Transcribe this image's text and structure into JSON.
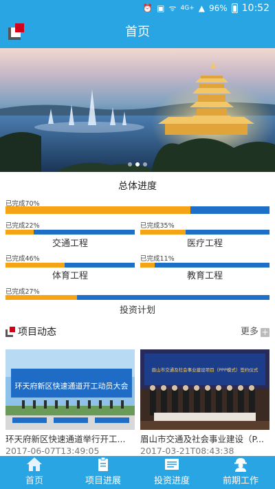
{
  "status_bar": {
    "battery": "96%",
    "time": "10:52",
    "network": "4G+"
  },
  "app_bar": {
    "title": "首页"
  },
  "banner": {
    "slides": 3,
    "active_slide": 1
  },
  "progress": {
    "title": "总体进度",
    "overall": {
      "text": "已完成70%",
      "percent": 70
    },
    "items": [
      {
        "text": "已完成22%",
        "label": "交通工程",
        "percent": 22
      },
      {
        "text": "已完成35%",
        "label": "医疗工程",
        "percent": 35
      },
      {
        "text": "已完成46%",
        "label": "体育工程",
        "percent": 46
      },
      {
        "text": "已完成11%",
        "label": "教育工程",
        "percent": 11
      },
      {
        "text": "已完成27%",
        "label": "投资计划",
        "percent": 27
      }
    ]
  },
  "news": {
    "title": "项目动态",
    "more": "更多",
    "cards": [
      {
        "title": "环天府新区快速通道举行开工...",
        "date": "2017-06-07T13:49:05",
        "image_caption": "环天府新区快速通道开工动员大会"
      },
      {
        "title": "眉山市交通及社会事业建设（P...",
        "date": "2017-03-21T08:43:38",
        "image_caption": "眉山市交通及社会事业建设项目（PPP模式）签约仪式"
      }
    ]
  },
  "nav": {
    "items": [
      {
        "label": "首页",
        "icon": "home-icon"
      },
      {
        "label": "项目进展",
        "icon": "clipboard-icon"
      },
      {
        "label": "投资进度",
        "icon": "list-icon"
      },
      {
        "label": "前期工作",
        "icon": "worker-icon"
      }
    ]
  },
  "colors": {
    "primary": "#2aa5e3",
    "progress_done": "#f5a417",
    "progress_remaining": "#1e6fc8"
  }
}
